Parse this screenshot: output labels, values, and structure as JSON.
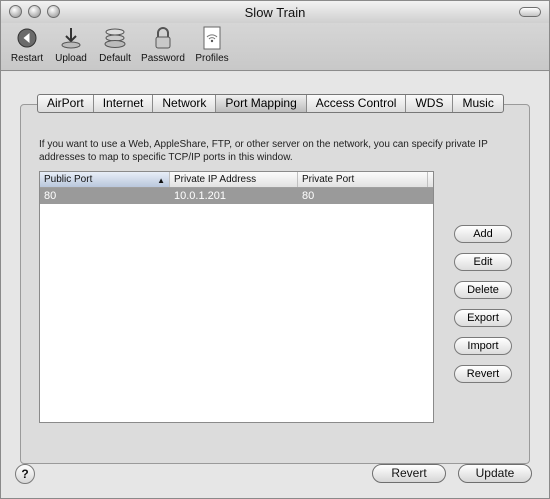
{
  "window": {
    "title": "Slow Train"
  },
  "toolbar": {
    "items": [
      {
        "label": "Restart",
        "icon": "restart-icon"
      },
      {
        "label": "Upload",
        "icon": "upload-icon"
      },
      {
        "label": "Default",
        "icon": "default-icon"
      },
      {
        "label": "Password",
        "icon": "lock-icon"
      },
      {
        "label": "Profiles",
        "icon": "profiles-icon"
      }
    ]
  },
  "tabs": [
    "AirPort",
    "Internet",
    "Network",
    "Port Mapping",
    "Access Control",
    "WDS",
    "Music"
  ],
  "selected_tab": "Port Mapping",
  "description": "If you want to use a Web, AppleShare, FTP, or other server on the network, you can specify private IP addresses to map to specific TCP/IP ports in this window.",
  "table": {
    "columns": [
      "Public Port",
      "Private IP Address",
      "Private Port"
    ],
    "rows": [
      [
        "80",
        "10.0.1.201",
        "80"
      ]
    ]
  },
  "side_buttons": [
    "Add",
    "Edit",
    "Delete",
    "Export",
    "Import",
    "Revert"
  ],
  "bottom": {
    "help": "?",
    "revert": "Revert",
    "update": "Update"
  }
}
